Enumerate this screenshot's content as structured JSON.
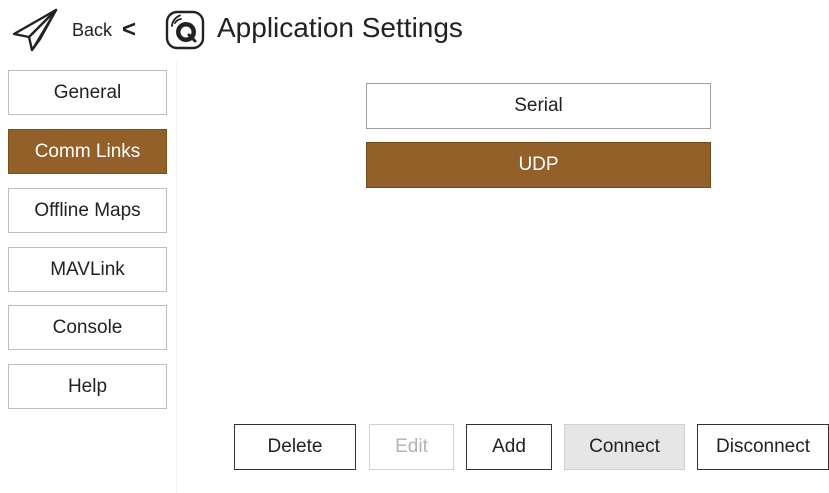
{
  "header": {
    "back_label": "Back",
    "chevron": "<",
    "title": "Application Settings",
    "back_icon": "paper-plane-icon",
    "logo_icon": "qgc-logo-icon"
  },
  "sidebar": {
    "items": [
      {
        "label": "General",
        "active": false
      },
      {
        "label": "Comm Links",
        "active": true
      },
      {
        "label": "Offline Maps",
        "active": false
      },
      {
        "label": "MAVLink",
        "active": false
      },
      {
        "label": "Console",
        "active": false
      },
      {
        "label": "Help",
        "active": false
      }
    ]
  },
  "links": {
    "items": [
      {
        "label": "Serial",
        "selected": false
      },
      {
        "label": "UDP",
        "selected": true
      }
    ]
  },
  "actions": {
    "delete_label": "Delete",
    "edit_label": "Edit",
    "add_label": "Add",
    "connect_label": "Connect",
    "disconnect_label": "Disconnect"
  },
  "colors": {
    "accent": "#93602a",
    "text": "#222222",
    "disabled_text": "#b4b4b4",
    "pressed_bg": "#e6e6e6"
  }
}
